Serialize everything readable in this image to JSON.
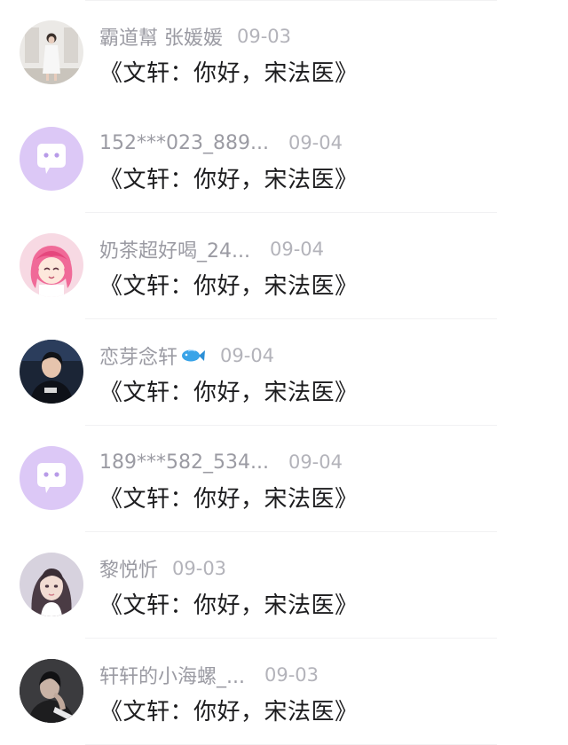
{
  "comments": [
    {
      "username": "152***023_889...",
      "date": "09-04",
      "text": "《文轩：你好，宋法医》",
      "avatar": "default-chat-avatar"
    },
    {
      "username": "奶茶超好喝_24...",
      "date": "09-04",
      "text": "《文轩：你好，宋法医》",
      "avatar": "anime-girl-avatar"
    },
    {
      "username": "恋芽念轩",
      "date": "09-04",
      "text": "《文轩：你好，宋法医》",
      "avatar": "person-photo-avatar",
      "badge": "fish-icon"
    },
    {
      "username": "189***582_534...",
      "date": "09-04",
      "text": "《文轩：你好，宋法医》",
      "avatar": "default-chat-avatar"
    },
    {
      "username": "黎悦忻",
      "date": "09-03",
      "text": "《文轩：你好，宋法医》",
      "avatar": "girl-portrait-avatar"
    },
    {
      "username": "轩轩的小海螺_...",
      "date": "09-03",
      "text": "《文轩：你好，宋法医》",
      "avatar": "dark-photo-avatar"
    },
    {
      "username": "霸道幫 张媛媛",
      "date": "09-03",
      "text": "《文轩：你好，宋法医》",
      "avatar": "room-photo-avatar"
    }
  ],
  "colors": {
    "default_avatar_bg": "#d9c4f5",
    "username": "#9b9ba3",
    "date": "#b3b3ba",
    "comment_text": "#1c1c1e"
  }
}
